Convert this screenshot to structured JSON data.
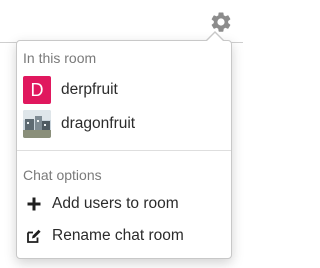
{
  "topbar": {
    "settings_icon": "gear-icon",
    "icon_color": "#8c8c8c"
  },
  "menu": {
    "room_section": {
      "header": "In this room",
      "members": [
        {
          "name": "derpfruit",
          "avatar_letter": "D",
          "avatar_color": "#e0185e",
          "avatar_type": "letter"
        },
        {
          "name": "dragonfruit",
          "avatar_type": "photo"
        }
      ]
    },
    "chat_options": {
      "header": "Chat options",
      "items": [
        {
          "label": "Add users to room",
          "icon": "plus-icon"
        },
        {
          "label": "Rename chat room",
          "icon": "edit-icon"
        }
      ]
    }
  }
}
